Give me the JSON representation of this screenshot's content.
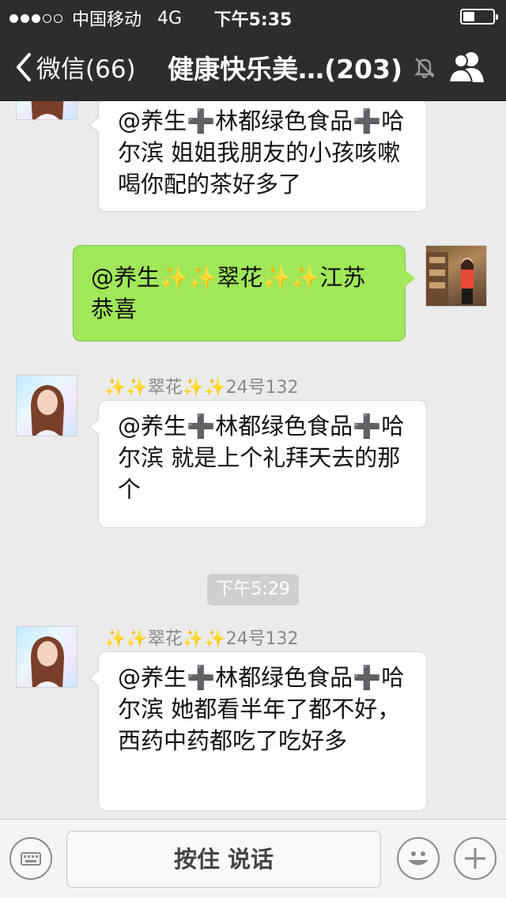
{
  "status_bar": {
    "carrier": "中国移动",
    "network": "4G",
    "time": "下午5:35",
    "battery_level": 0.4
  },
  "nav": {
    "back_label": "微信(66)",
    "title": "健康快乐美…(203)",
    "icons": [
      "back-chevron-icon",
      "mute-bell-icon",
      "group-members-icon"
    ]
  },
  "messages": [
    {
      "direction": "in",
      "text": "@养生➕林都绿色食品➕哈尔滨 姐姐我朋友的小孩咳嗽喝你配的茶好多了"
    },
    {
      "direction": "out",
      "text": "@养生✨✨翠花✨✨江苏 恭喜"
    },
    {
      "direction": "in",
      "sender": "✨✨翠花✨✨24号132",
      "text": "@养生➕林都绿色食品➕哈尔滨 就是上个礼拜天去的那个"
    },
    {
      "direction": "in",
      "sender": "✨✨翠花✨✨24号132",
      "text": "@养生➕林都绿色食品➕哈尔滨 她都看半年了都不好，西药中药都吃了吃好多"
    }
  ],
  "timestamp": "下午5:29",
  "input_bar": {
    "hold_to_talk_label": "按住 说话",
    "icons": [
      "keyboard-icon",
      "emoji-icon",
      "plus-icon"
    ]
  },
  "colors": {
    "nav_bg": "#2d2d2d",
    "outgoing_bubble": "#a0e75a",
    "chat_bg": "#ebebeb"
  }
}
